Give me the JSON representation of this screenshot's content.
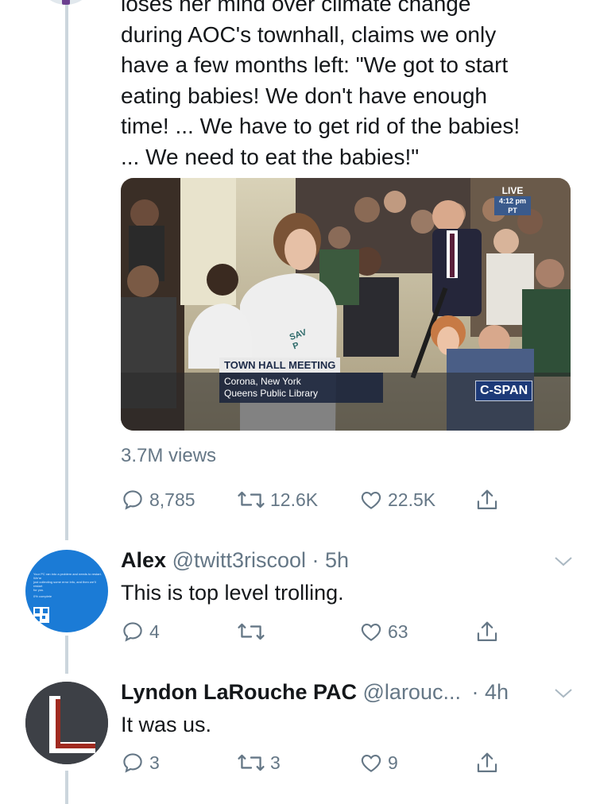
{
  "main_tweet": {
    "text_lines": [
      "loses her mind over climate change",
      "during AOC's townhall, claims we only",
      "have a few months left: \"We got to start",
      "eating babies! We don't have enough",
      "time! ...  We have to get rid of the babies!",
      "... We need to eat the babies!\""
    ],
    "media": {
      "live_label": "LIVE",
      "live_time": "4:12 pm PT",
      "banner_title": "TOWN HALL MEETING",
      "banner_line1": "Corona, New York",
      "banner_line2": "Queens Public Library",
      "network": "C-SPAN",
      "shirt_text": "SAV P"
    },
    "views": "3.7M views",
    "replies": "8,785",
    "retweets": "12.6K",
    "likes": "22.5K"
  },
  "replies": [
    {
      "name": "Alex",
      "handle": "@twitt3riscool",
      "time": "· 5h",
      "text": "This is top level trolling.",
      "reply_count": "4",
      "retweet_count": "",
      "like_count": "63",
      "avatar_lines": [
        "Your PC ran into a problem and needs to restart. We're",
        "just collecting some error info, and then we'll restart",
        "for you.",
        "0% complete"
      ]
    },
    {
      "name": "Lyndon LaRouche PAC",
      "handle": "@larouc...",
      "time": "· 4h",
      "text": "It was us.",
      "reply_count": "3",
      "retweet_count": "3",
      "like_count": "9"
    }
  ],
  "colors": {
    "secondary_text": "#657786",
    "thread_line": "#ccd6dd",
    "bsod_blue": "#1b7bd6"
  }
}
